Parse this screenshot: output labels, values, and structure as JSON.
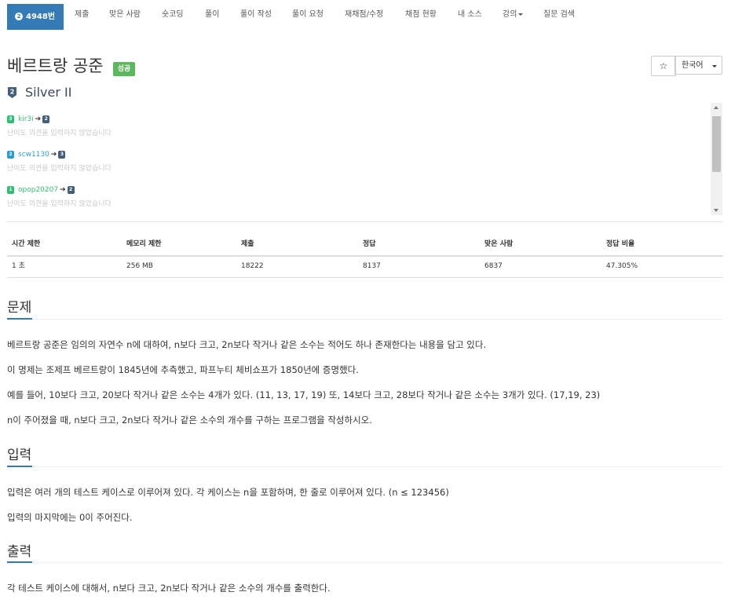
{
  "nav": {
    "problem_number": "4948번",
    "tier_digit": "2",
    "items": [
      "제출",
      "맞은 사람",
      "숏코딩",
      "풀이",
      "풀이 작성",
      "풀이 요청",
      "재채점/수정",
      "채점 현황",
      "내 소스",
      "강의",
      "질문 검색"
    ]
  },
  "title": "베르트랑 공준",
  "status_badge": "성공",
  "star_icon": "☆",
  "language": "한국어",
  "tier": {
    "digit": "2",
    "label": "Silver II"
  },
  "difficulty_opinions": [
    {
      "from_digit": "3",
      "from_color": "#2fbf71",
      "user": "kir3i",
      "to_digit": "2",
      "message": "난이도 의견을 입력하지 않았습니다"
    },
    {
      "from_digit": "2",
      "from_color": "#2a9dd6",
      "user": "scw1130",
      "to_digit": "3",
      "message": "난이도 의견을 입력하지 않았습니다"
    },
    {
      "from_digit": "1",
      "from_color": "#2fbf71",
      "user": "opop20207",
      "to_digit": "2",
      "message": "난이도 의견을 입력하지 않았습니다"
    }
  ],
  "stats": {
    "headers": [
      "시간 제한",
      "메모리 제한",
      "제출",
      "정답",
      "맞은 사람",
      "정답 비율"
    ],
    "values": [
      "1 초",
      "256 MB",
      "18222",
      "8137",
      "6837",
      "47.305%"
    ]
  },
  "sections": {
    "problem": {
      "title": "문제",
      "paragraphs": [
        "베르트랑 공준은 임의의 자연수 n에 대하여, n보다 크고, 2n보다 작거나 같은 소수는 적어도 하나 존재한다는 내용을 담고 있다.",
        "이 명제는 조제프 베르트랑이 1845년에 추측했고, 파프누티 체비쇼프가 1850년에 증명했다.",
        "예를 들어, 10보다 크고, 20보다 작거나 같은 소수는 4개가 있다. (11, 13, 17, 19) 또, 14보다 크고, 28보다 작거나 같은 소수는 3개가 있다. (17,19, 23)",
        "n이 주어졌을 때, n보다 크고, 2n보다 작거나 같은 소수의 개수를 구하는 프로그램을 작성하시오."
      ]
    },
    "input": {
      "title": "입력",
      "paragraphs": [
        "입력은 여러 개의 테스트 케이스로 이루어져 있다. 각 케이스는 n을 포함하며, 한 줄로 이루어져 있다. (n ≤ 123456)",
        "입력의 마지막에는 0이 주어진다."
      ]
    },
    "output": {
      "title": "출력",
      "paragraphs": [
        "각 테스트 케이스에 대해서, n보다 크고, 2n보다 작거나 같은 소수의 개수를 출력한다."
      ]
    }
  }
}
